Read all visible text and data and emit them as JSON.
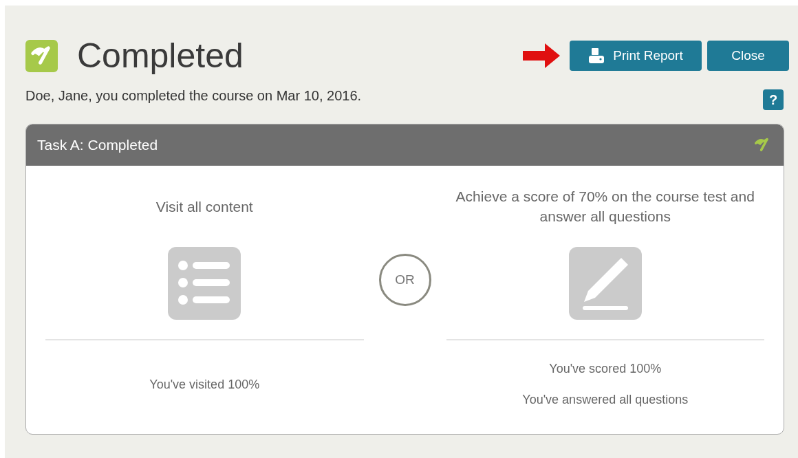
{
  "header": {
    "title": "Completed",
    "subtitle": "Doe, Jane, you completed the course on Mar 10, 2016.",
    "buttons": [
      {
        "label": "Print Report",
        "kind": "print"
      },
      {
        "label": "Close",
        "kind": "plain"
      }
    ],
    "help": "?"
  },
  "task": {
    "title": "Task A: Completed",
    "separator": "OR",
    "criteria": [
      {
        "heading": "Visit all content",
        "kind": "list",
        "results": [
          "You've visited 100%"
        ]
      },
      {
        "heading": "Achieve a score of 70% on the course test and answer all questions",
        "kind": "pencil",
        "results": [
          "You've scored 100%",
          "You've answered all questions"
        ]
      }
    ]
  }
}
